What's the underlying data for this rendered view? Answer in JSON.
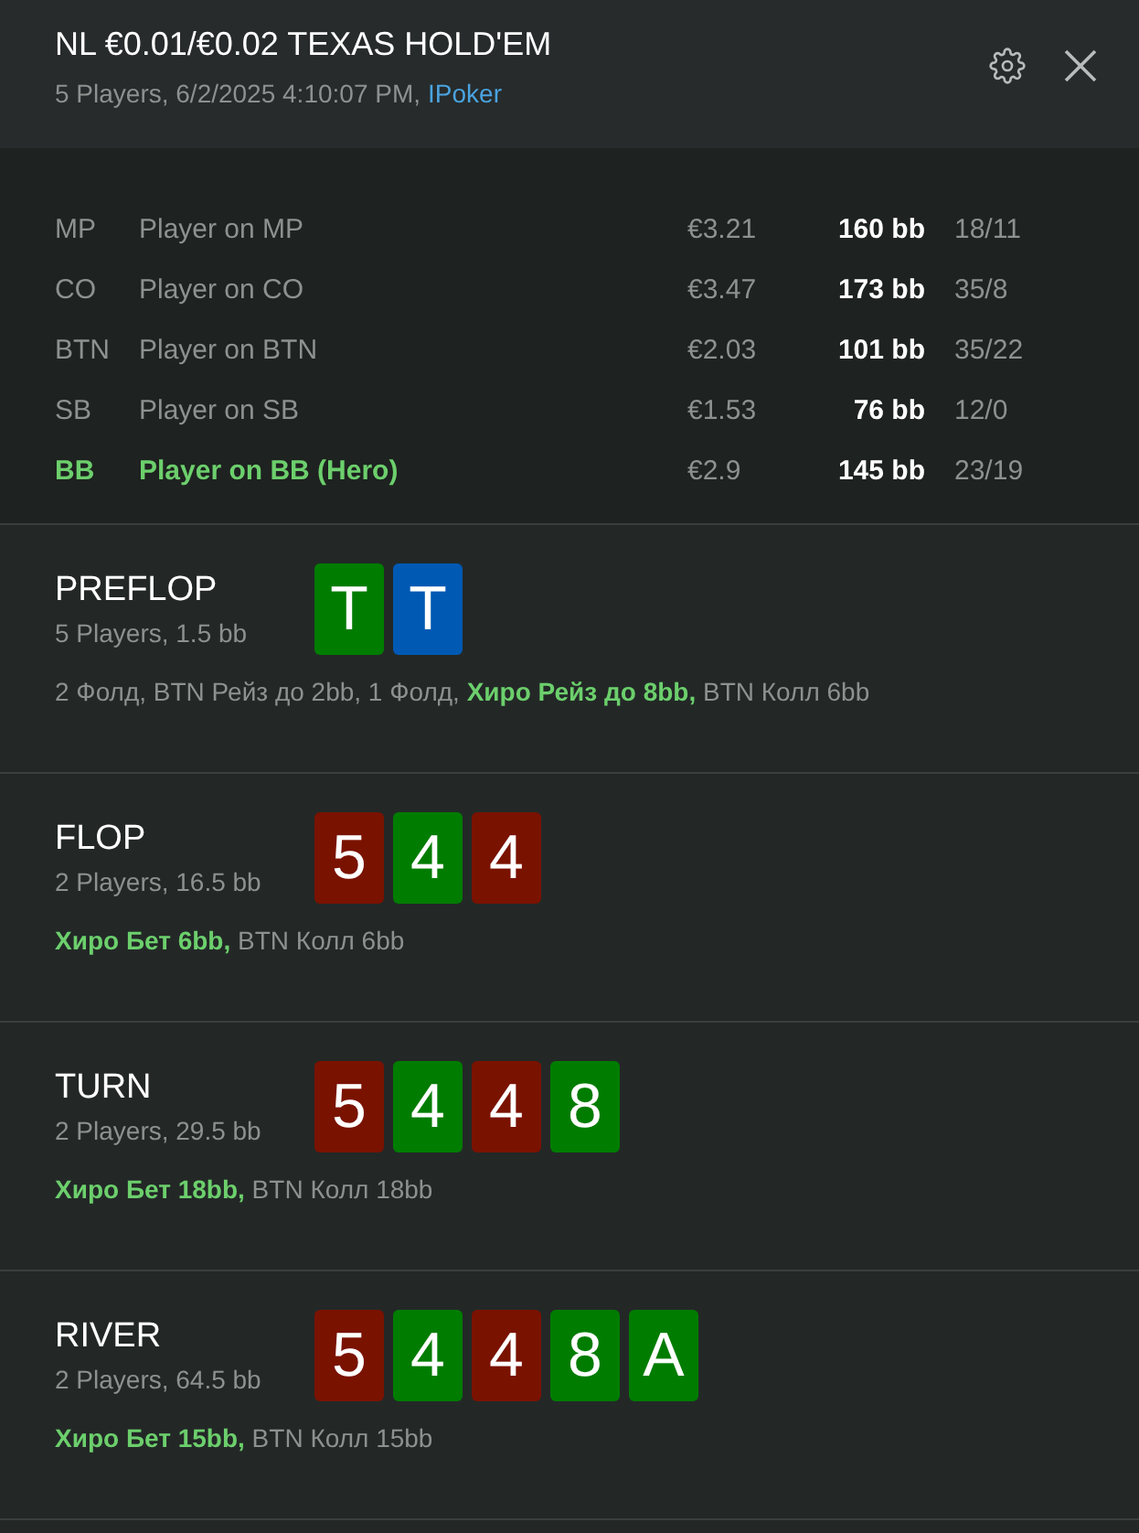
{
  "header": {
    "title": "NL €0.01/€0.02 TEXAS HOLD'EM",
    "info": "5 Players, 6/2/2025 4:10:07 PM,",
    "site": "IPoker"
  },
  "players": [
    {
      "position": "MP",
      "name": "Player on MP",
      "money": "€3.21",
      "stack": "160 bb",
      "stats": "18/11",
      "hero": false
    },
    {
      "position": "CO",
      "name": "Player on CO",
      "money": "€3.47",
      "stack": "173 bb",
      "stats": "35/8",
      "hero": false
    },
    {
      "position": "BTN",
      "name": "Player on BTN",
      "money": "€2.03",
      "stack": "101 bb",
      "stats": "35/22",
      "hero": false
    },
    {
      "position": "SB",
      "name": "Player on SB",
      "money": "€1.53",
      "stack": "76 bb",
      "stats": "12/0",
      "hero": false
    },
    {
      "position": "BB",
      "name": "Player on BB (Hero)",
      "money": "€2.9",
      "stack": "145 bb",
      "stats": "23/19",
      "hero": true
    }
  ],
  "streets": [
    {
      "name": "PREFLOP",
      "info": "5 Players, 1.5 bb",
      "cards": [
        {
          "rank": "T",
          "color": "#007c00"
        },
        {
          "rank": "T",
          "color": "#0059b3"
        }
      ],
      "actions": "2 Фолд, BTN Рейз до 2bb, 1 Фолд, **Хиро Рейз до 8bb,** BTN Колл 6bb"
    },
    {
      "name": "FLOP",
      "info": "2 Players, 16.5 bb",
      "cards": [
        {
          "rank": "5",
          "color": "#7a1200"
        },
        {
          "rank": "4",
          "color": "#007c00"
        },
        {
          "rank": "4",
          "color": "#7a1200"
        }
      ],
      "actions": "**Хиро Бет 6bb,** BTN Колл 6bb"
    },
    {
      "name": "TURN",
      "info": "2 Players, 29.5 bb",
      "cards": [
        {
          "rank": "5",
          "color": "#7a1200"
        },
        {
          "rank": "4",
          "color": "#007c00"
        },
        {
          "rank": "4",
          "color": "#7a1200"
        },
        {
          "rank": "8",
          "color": "#007c00"
        }
      ],
      "actions": "**Хиро Бет 18bb,** BTN Колл 18bb"
    },
    {
      "name": "RIVER",
      "info": "2 Players, 64.5 bb",
      "cards": [
        {
          "rank": "5",
          "color": "#7a1200"
        },
        {
          "rank": "4",
          "color": "#007c00"
        },
        {
          "rank": "4",
          "color": "#7a1200"
        },
        {
          "rank": "8",
          "color": "#007c00"
        },
        {
          "rank": "A",
          "color": "#007c00"
        }
      ],
      "actions": "**Хиро Бет 15bb,** BTN Колл 15bb"
    }
  ]
}
